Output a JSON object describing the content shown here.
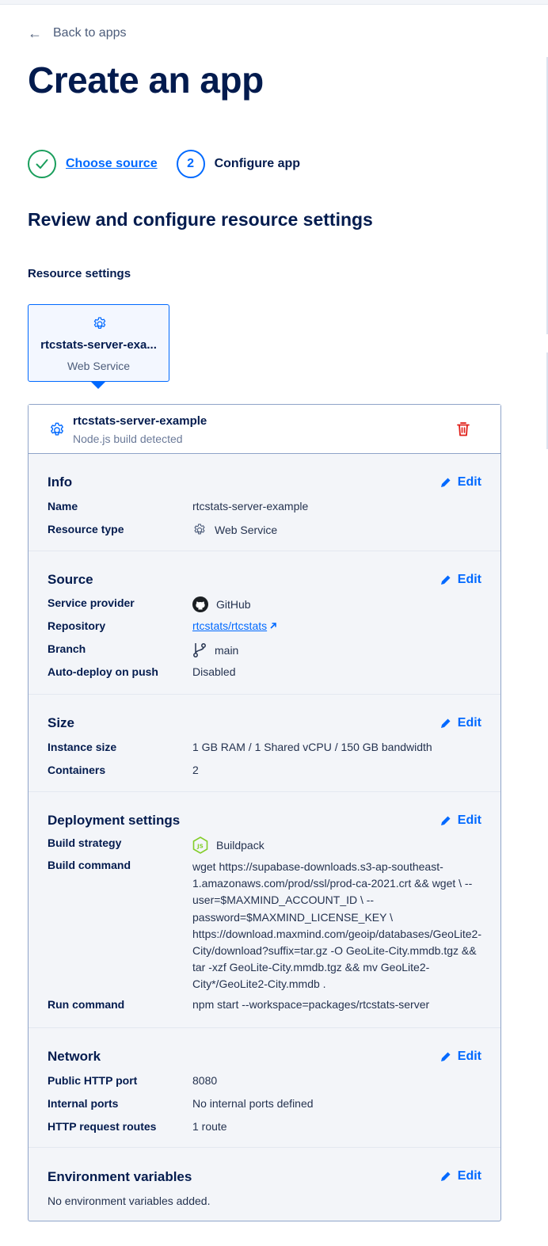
{
  "nav": {
    "back_label": "Back to apps"
  },
  "page": {
    "title": "Create an app",
    "section_title": "Review and configure resource settings",
    "resource_settings_label": "Resource settings"
  },
  "stepper": {
    "steps": [
      {
        "number": "1",
        "label": "Choose source",
        "state": "done"
      },
      {
        "number": "2",
        "label": "Configure app",
        "state": "current"
      }
    ]
  },
  "resource_card": {
    "name": "rtcstats-server-exa...",
    "type": "Web Service",
    "icon": "gear-icon"
  },
  "panel": {
    "name": "rtcstats-server-example",
    "subtitle": "Node.js build detected",
    "edit_label": "Edit",
    "info": {
      "title": "Info",
      "name_key": "Name",
      "name_value": "rtcstats-server-example",
      "type_key": "Resource type",
      "type_value": "Web Service"
    },
    "source": {
      "title": "Source",
      "provider_key": "Service provider",
      "provider_value": "GitHub",
      "repo_key": "Repository",
      "repo_value": "rtcstats/rtcstats",
      "branch_key": "Branch",
      "branch_value": "main",
      "autodeploy_key": "Auto-deploy on push",
      "autodeploy_value": "Disabled"
    },
    "size": {
      "title": "Size",
      "instance_key": "Instance size",
      "instance_value": "1 GB RAM / 1 Shared vCPU / 150 GB bandwidth",
      "containers_key": "Containers",
      "containers_value": "2"
    },
    "deployment": {
      "title": "Deployment settings",
      "strategy_key": "Build strategy",
      "strategy_value": "Buildpack",
      "build_key": "Build command",
      "build_lines": [
        "wget https://supabase-downloads.s3-ap-southeast-",
        "1.amazonaws.com/prod/ssl/prod-ca-2021.crt && wget \\ --",
        "user=$MAXMIND_ACCOUNT_ID \\ --",
        "password=$MAXMIND_LICENSE_KEY \\",
        "https://download.maxmind.com/geoip/databases/GeoLite2-",
        "City/download?suffix=tar.gz -O GeoLite-City.mmdb.tgz &&",
        "tar -xzf GeoLite-City.mmdb.tgz && mv GeoLite2-",
        "City*/GeoLite2-City.mmdb ."
      ],
      "run_key": "Run command",
      "run_value": "npm start --workspace=packages/rtcstats-server"
    },
    "network": {
      "title": "Network",
      "http_port_key": "Public HTTP port",
      "http_port_value": "8080",
      "internal_key": "Internal ports",
      "internal_value": "No internal ports defined",
      "routes_key": "HTTP request routes",
      "routes_value": "1 route"
    },
    "env": {
      "title": "Environment variables",
      "empty_text": "No environment variables added."
    }
  },
  "colors": {
    "accent": "#0069ff",
    "success": "#1a9e5c",
    "danger": "#e0201a",
    "text": "#031b4e"
  }
}
